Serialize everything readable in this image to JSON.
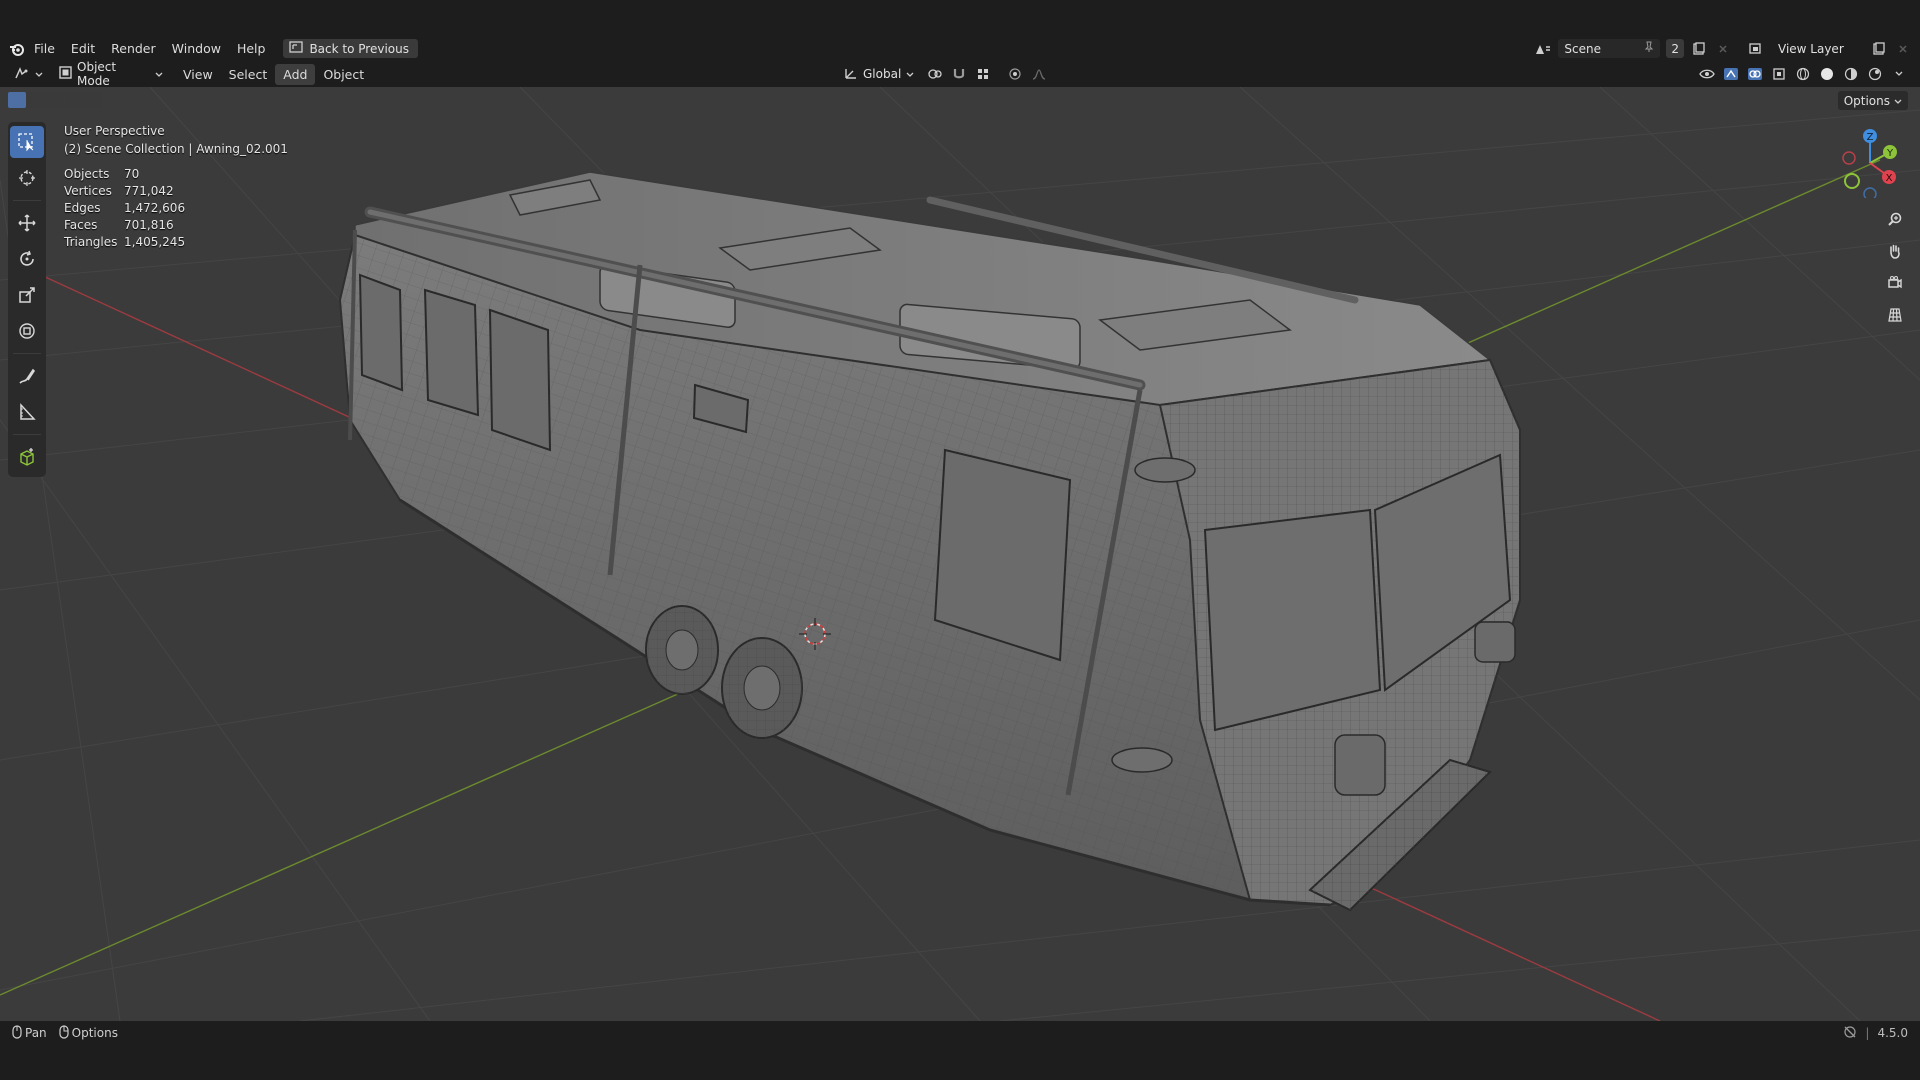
{
  "topbar": {
    "menus": [
      "File",
      "Edit",
      "Render",
      "Window",
      "Help"
    ],
    "back_button": "Back to Previous",
    "scene_name": "Scene",
    "scene_users": "2",
    "view_layer": "View Layer"
  },
  "header": {
    "mode": "Object Mode",
    "menus": [
      "View",
      "Select",
      "Add",
      "Object"
    ],
    "active_menu": "Add",
    "transform_orientation": "Global"
  },
  "viewport": {
    "options_label": "Options",
    "perspective_label": "User Perspective",
    "collection_label": "(2) Scene Collection | Awning_02.001",
    "stats": [
      {
        "label": "Objects",
        "value": "70"
      },
      {
        "label": "Vertices",
        "value": "771,042"
      },
      {
        "label": "Edges",
        "value": "1,472,606"
      },
      {
        "label": "Faces",
        "value": "701,816"
      },
      {
        "label": "Triangles",
        "value": "1,405,245"
      }
    ],
    "gizmo": {
      "x": "X",
      "y": "Y",
      "z": "Z"
    }
  },
  "statusbar": {
    "pan_label": "Pan",
    "options_label": "Options",
    "version": "4.5.0"
  },
  "colors": {
    "accent": "#4772b3",
    "x_axis": "#e0434f",
    "y_axis": "#8dc43a",
    "z_axis": "#3f8ee0",
    "viewport_bg": "#3b3b3b"
  }
}
